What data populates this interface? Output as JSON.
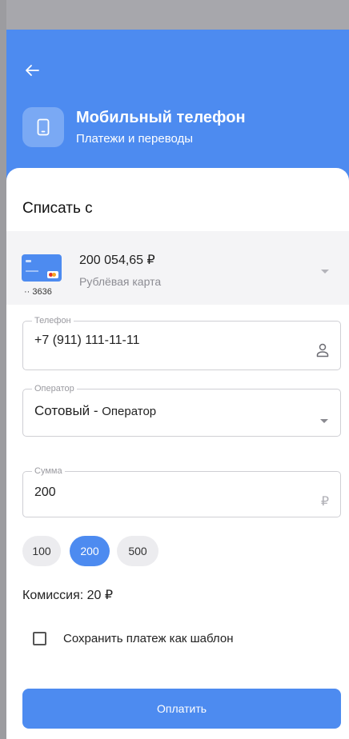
{
  "header": {
    "title": "Мобильный телефон",
    "subtitle": "Платежи и переводы"
  },
  "debit": {
    "section_title": "Списать с",
    "card": {
      "amount": "200 054,65 ₽",
      "type": "Рублёвая карта",
      "number": "·· 3636"
    }
  },
  "phone_field": {
    "legend": "Телефон",
    "value": "+7 (911) 111-11-11",
    "icon": "person-icon"
  },
  "operator_field": {
    "legend": "Оператор",
    "value_main": "Сотовый - ",
    "value_sub": "Оператор"
  },
  "amount_field": {
    "legend": "Сумма",
    "value": "200",
    "currency": "₽"
  },
  "quick_amounts": [
    "100",
    "200",
    "500"
  ],
  "quick_amount_selected": "200",
  "commission": "Комиссия: 20 ₽",
  "save_template": {
    "label": "Сохранить платеж как шаблон",
    "checked": false
  },
  "pay_button": "Оплатить",
  "colors": {
    "accent": "#4d8bf0",
    "statusbar": "#a7a7ac"
  }
}
